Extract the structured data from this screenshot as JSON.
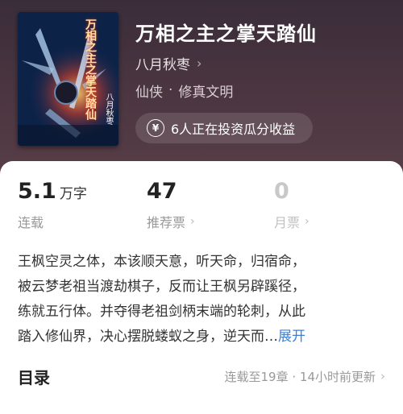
{
  "book": {
    "title": "万相之主之掌天踏仙",
    "author": "八月秋枣",
    "genre1": "仙侠",
    "genre2": "修真文明",
    "invest_text": "6人正在投资瓜分收益",
    "cover_title": "万相之主之掌天踏仙",
    "cover_author": "八月秋枣"
  },
  "stats": {
    "words_value": "5.1",
    "words_unit": "万字",
    "words_label": "连载",
    "rec_value": "47",
    "rec_label": "推荐票",
    "month_value": "0",
    "month_label": "月票"
  },
  "synopsis": {
    "line1": "王枫空灵之体，本该顺天意，听天命，归宿命，",
    "line2": "被云梦老祖当渡劫棋子，反而让王枫另辟蹊径，",
    "line3": "练就五行体。并夺得老祖剑柄末端的轮刺，从此",
    "line4": "踏入修仙界，决心摆脱蝼蚁之身，逆天而…",
    "expand": "展开"
  },
  "toc": {
    "title": "目录",
    "status": "连载至19章 · 14小时前更新"
  },
  "icons": {
    "chevron": "chevron-right-icon",
    "yen": "yen-circle-icon"
  },
  "colors": {
    "link": "#3d7fd8",
    "header_bg": "#4a3540"
  }
}
